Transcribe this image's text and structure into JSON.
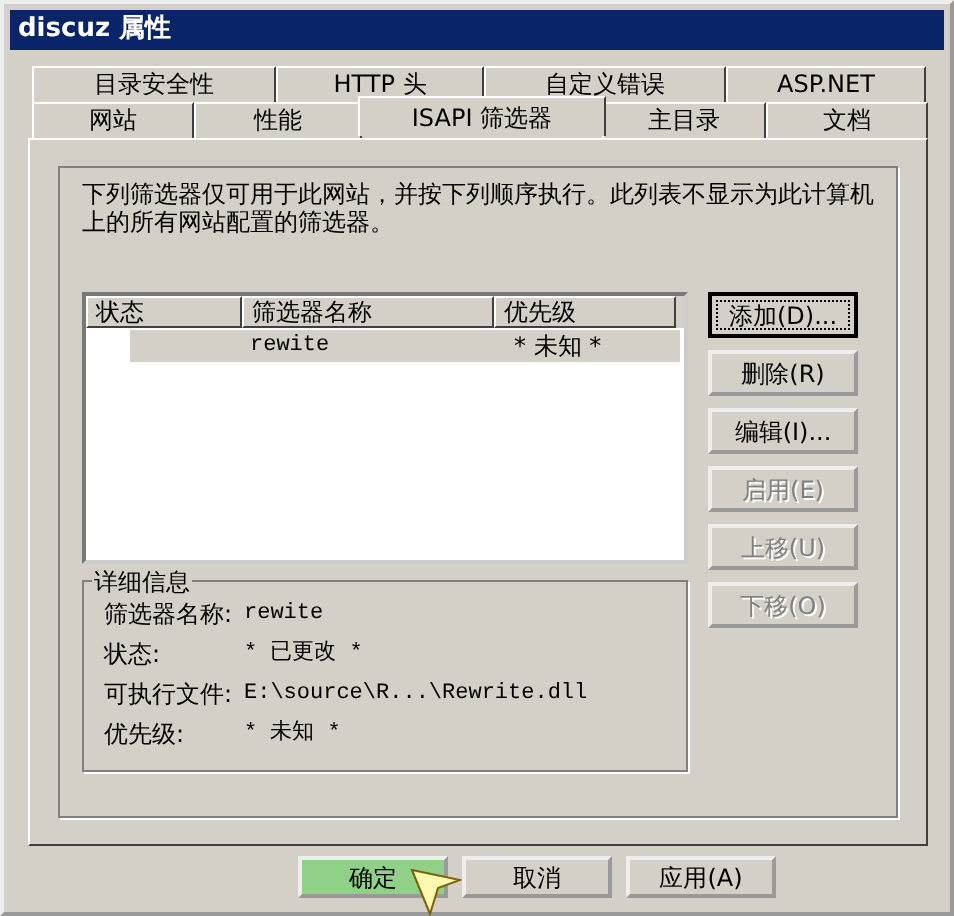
{
  "window": {
    "title": "discuz 属性"
  },
  "tab_rows": [
    {
      "tabs": [
        {
          "label": "目录安全性",
          "selected": false
        },
        {
          "label": "HTTP 头",
          "selected": false
        },
        {
          "label": "自定义错误",
          "selected": false
        },
        {
          "label": "ASP.NET",
          "selected": false
        }
      ]
    },
    {
      "tabs": [
        {
          "label": "网站",
          "selected": false
        },
        {
          "label": "性能",
          "selected": false
        },
        {
          "label": "ISAPI 筛选器",
          "selected": true
        },
        {
          "label": "主目录",
          "selected": false
        },
        {
          "label": "文档",
          "selected": false
        }
      ]
    }
  ],
  "description": "下列筛选器仅可用于此网站，并按下列顺序执行。此列表不显示为此计算机上的所有网站配置的筛选器。",
  "filter_list": {
    "columns": [
      "状态",
      "筛选器名称",
      "优先级"
    ],
    "rows": [
      {
        "name": "rewite",
        "priority": "* 未知 *",
        "selected": true
      }
    ]
  },
  "side_buttons": [
    {
      "label": "添加(D)...",
      "disabled": false,
      "focused": true
    },
    {
      "label": "删除(R)",
      "disabled": false,
      "focused": false
    },
    {
      "label": "编辑(I)...",
      "disabled": false,
      "focused": false
    },
    {
      "label": "启用(E)",
      "disabled": true,
      "focused": false
    },
    {
      "label": "上移(U)",
      "disabled": true,
      "focused": false
    },
    {
      "label": "下移(O)",
      "disabled": true,
      "focused": false
    }
  ],
  "details": {
    "legend": "详细信息",
    "fields": [
      {
        "label": "筛选器名称:",
        "value": "rewite"
      },
      {
        "label": "状态:",
        "value": "* 已更改 *"
      },
      {
        "label": "可执行文件:",
        "value": "E:\\source\\R...\\Rewrite.dll"
      },
      {
        "label": "优先级:",
        "value": "* 未知 *"
      }
    ]
  },
  "dialog_buttons": [
    {
      "label": "确定",
      "highlighted": true
    },
    {
      "label": "取消",
      "highlighted": false
    },
    {
      "label": "应用(A)",
      "highlighted": false
    }
  ]
}
